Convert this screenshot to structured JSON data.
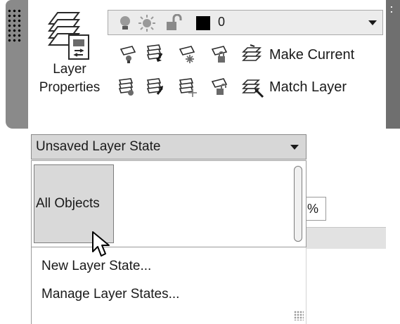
{
  "ribbon": {
    "layer_properties_label_line1": "Layer",
    "layer_properties_label_line2": "Properties",
    "layer_combo_value": "0",
    "color_swatch": "#000000",
    "make_current_label": "Make Current",
    "match_layer_label": "Match Layer",
    "side_strip_glyph": "⠅"
  },
  "layer_state": {
    "selected_value": "Unsaved Layer State",
    "list_items": [
      "All Objects"
    ],
    "menu_items": [
      "New Layer State...",
      "Manage Layer States..."
    ]
  },
  "background_field": {
    "value_fragment": ")%"
  },
  "icons": {
    "grip": "grip-icon",
    "layer_properties": "layer-properties-icon",
    "bulb": "bulb-icon",
    "sun": "sun-icon",
    "lock": "unlock-icon",
    "cursor": "mouse-cursor-icon"
  }
}
